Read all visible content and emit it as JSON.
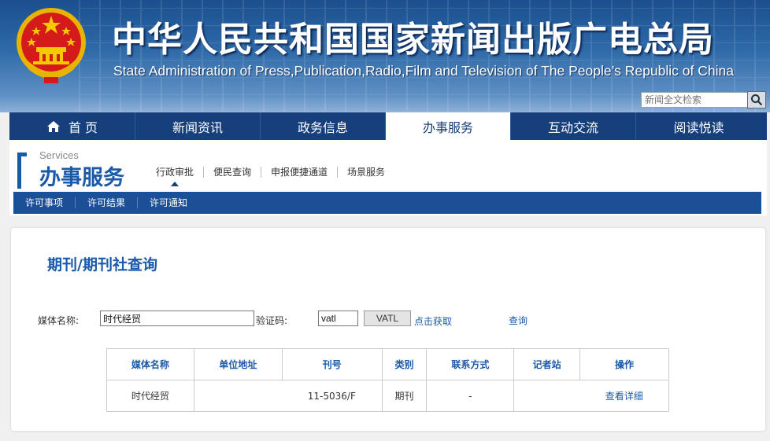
{
  "header": {
    "title_cn": "中华人民共和国国家新闻出版广电总局",
    "title_en": "State Administration of Press,Publication,Radio,Film and Television of The People’s Republic of China",
    "search_placeholder": "新闻全文检索",
    "emblem_icon": "national-emblem-icon",
    "search_icon": "search-icon"
  },
  "main_nav": {
    "items": [
      "首 页",
      "新闻资讯",
      "政务信息",
      "办事服务",
      "互动交流",
      "阅读悦读"
    ],
    "active_index": 3,
    "home_icon": "home-icon"
  },
  "services": {
    "en_label": "Services",
    "cn_label": "办事服务",
    "subnav": [
      "行政审批",
      "便民查询",
      "申报便捷通道",
      "场景服务"
    ],
    "subnav_active_index": 0,
    "subbar": [
      "许可事项",
      "许可结果",
      "许可通知"
    ]
  },
  "page": {
    "title": "期刊/期刊社查询"
  },
  "form": {
    "media_name_label": "媒体名称:",
    "media_name_value": "时代经贸",
    "captcha_label": "验证码:",
    "captcha_value": "vatl",
    "captcha_image_text": "VATL",
    "get_captcha_link": "点击获取",
    "query_link": "查询"
  },
  "table": {
    "headers": [
      "媒体名称",
      "单位地址",
      "刊号",
      "类别",
      "联系方式",
      "记者站",
      "操作"
    ],
    "rows": [
      [
        "时代经贸",
        "",
        "11-5036/F",
        "期刊",
        "-",
        "",
        "查看详细"
      ]
    ]
  },
  "colors": {
    "brand_blue": "#163f7c",
    "accent_blue": "#1b5aa8"
  }
}
